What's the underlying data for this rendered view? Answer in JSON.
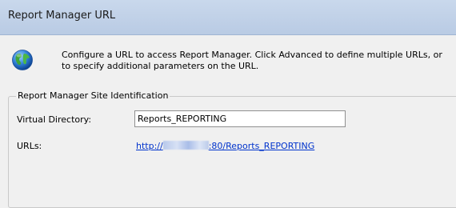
{
  "header": {
    "title": "Report Manager URL"
  },
  "intro": {
    "icon": "globe-icon",
    "text": "Configure a URL to access Report Manager.  Click Advanced to define multiple URLs, or to specify additional parameters on the URL."
  },
  "site_identification": {
    "legend": "Report Manager Site Identification",
    "virtual_directory_label": "Virtual Directory:",
    "virtual_directory_value": "Reports_REPORTING",
    "urls_label": "URLs:",
    "url_prefix": "http://",
    "url_suffix": ":80/Reports_REPORTING"
  }
}
